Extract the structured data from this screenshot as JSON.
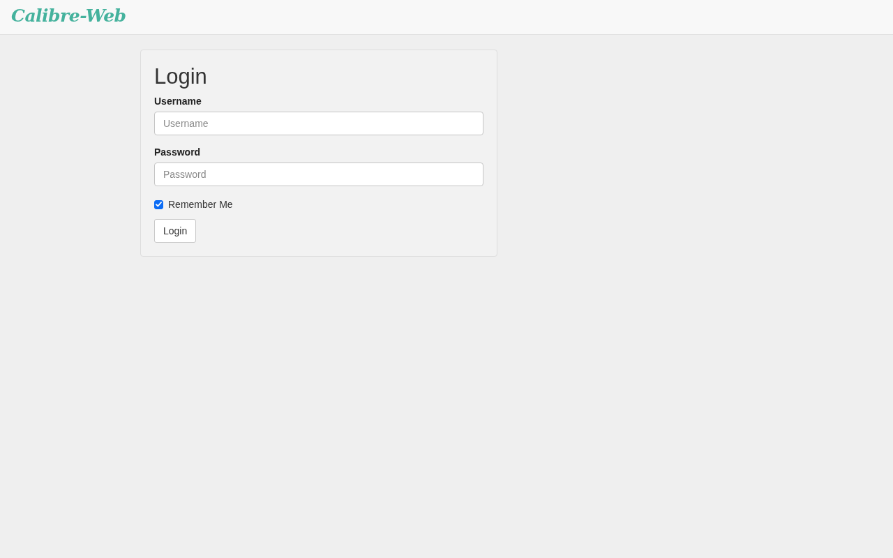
{
  "navbar": {
    "brand": "Calibre-Web"
  },
  "login": {
    "title": "Login",
    "fields": [
      {
        "label": "Username",
        "placeholder": "Username"
      },
      {
        "label": "Password",
        "placeholder": "Password"
      }
    ],
    "remember": {
      "label": "Remember Me",
      "checked": true
    },
    "button": "Login"
  }
}
